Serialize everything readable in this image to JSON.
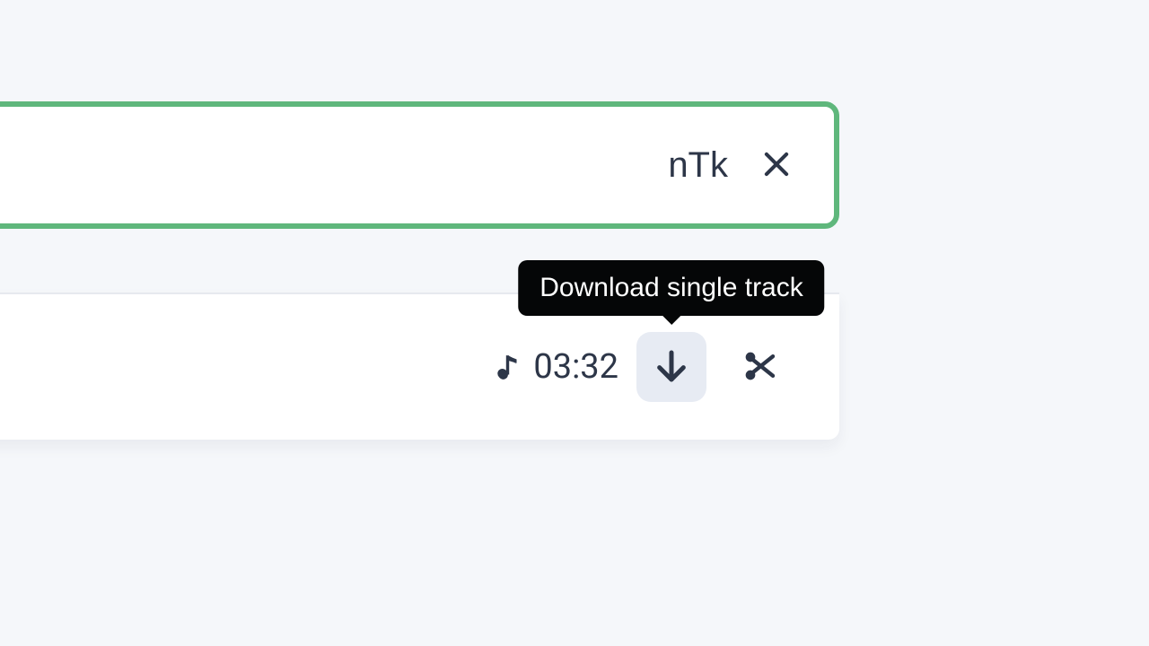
{
  "input": {
    "value_fragment": "nTk"
  },
  "track": {
    "duration": "03:32"
  },
  "tooltip": {
    "download": "Download single track"
  }
}
